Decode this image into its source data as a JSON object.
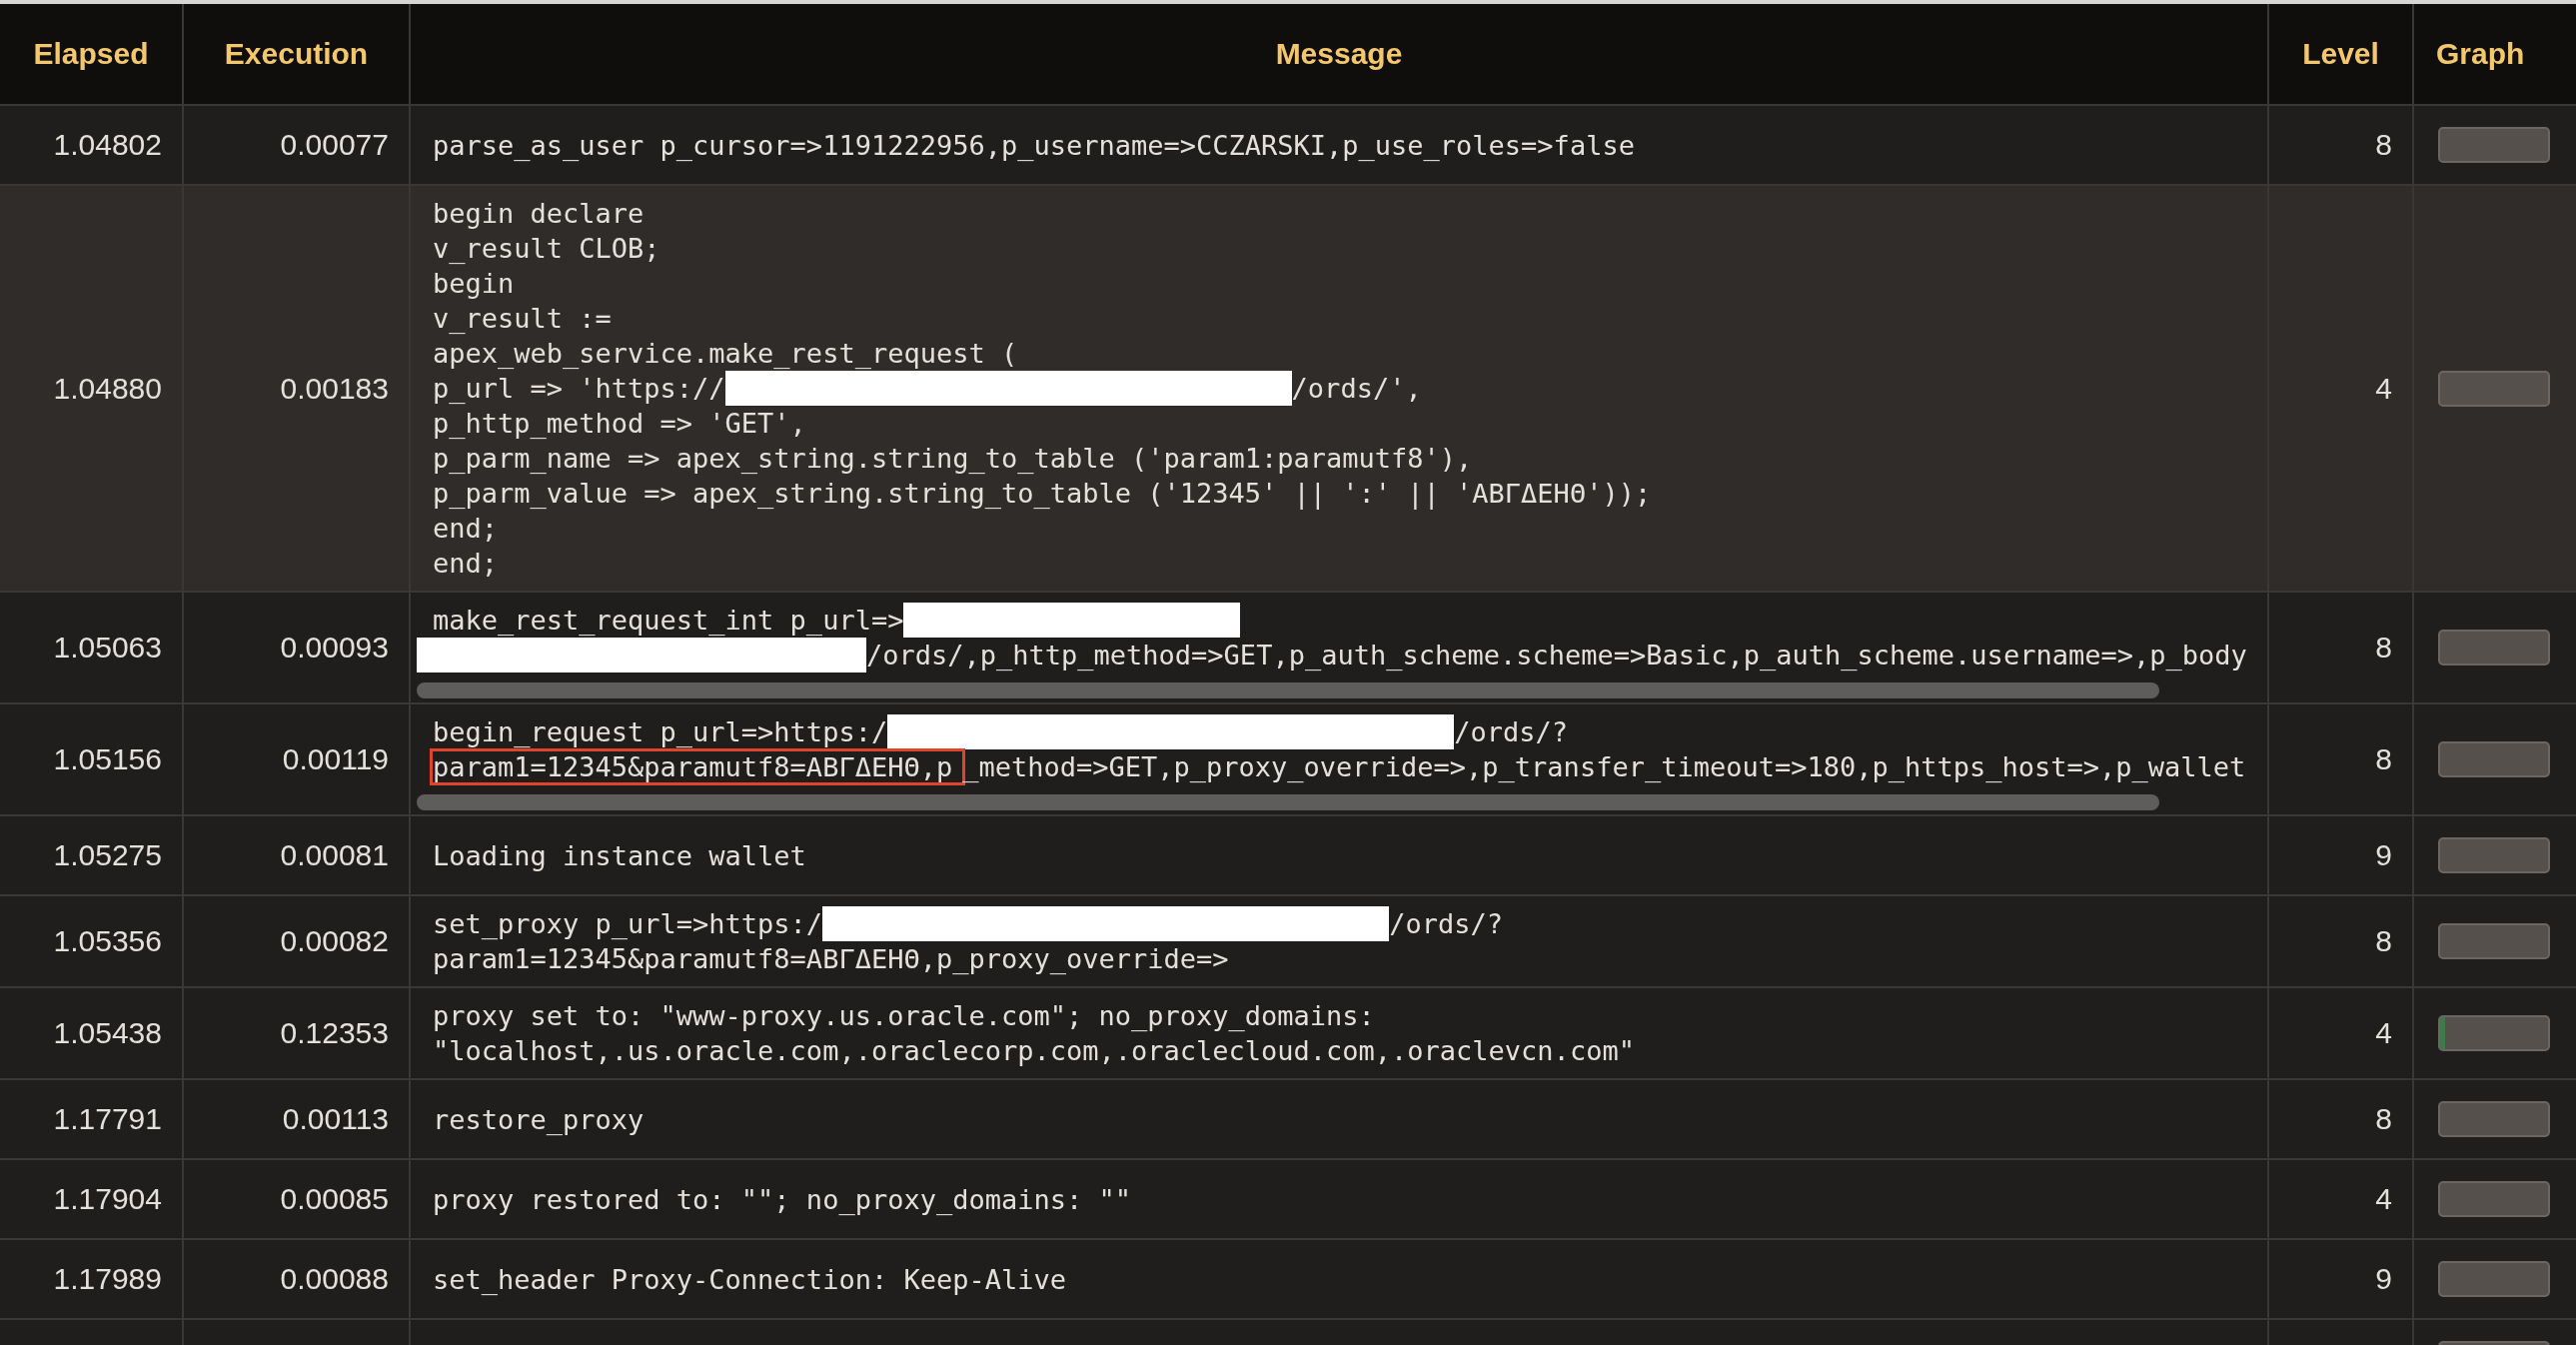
{
  "table": {
    "columns": [
      "Elapsed",
      "Execution",
      "Message",
      "Level",
      "Graph"
    ],
    "rows": [
      {
        "elapsed": "1.04802",
        "execution": "0.00077",
        "hovered": false,
        "scrollable": false,
        "message": [
          [
            {
              "kind": "text",
              "text": "parse_as_user p_cursor=>1191222956,p_username=>CCZARSKI,p_use_roles=>false"
            }
          ]
        ],
        "level_text": "8"
      },
      {
        "elapsed": "1.04880",
        "execution": "0.00183",
        "hovered": true,
        "scrollable": false,
        "message": [
          [
            {
              "kind": "text",
              "text": "begin declare"
            }
          ],
          [
            {
              "kind": "text",
              "text": "v_result CLOB;"
            }
          ],
          [
            {
              "kind": "text",
              "text": "begin"
            }
          ],
          [
            {
              "kind": "text",
              "text": "v_result :="
            }
          ],
          [
            {
              "kind": "text",
              "text": "apex_web_service.make_rest_request ("
            }
          ],
          [
            {
              "kind": "text",
              "text": "p_url => 'https://"
            },
            {
              "kind": "redacted"
            },
            {
              "kind": "text",
              "text": "/ords/',"
            }
          ],
          [
            {
              "kind": "text",
              "text": "p_http_method => 'GET',"
            }
          ],
          [
            {
              "kind": "text",
              "text": "p_parm_name => apex_string.string_to_table ('param1:paramutf8'),"
            }
          ],
          [
            {
              "kind": "text",
              "text": "p_parm_value => apex_string.string_to_table ('12345' || ':' || 'ΑΒΓΔΕΗΘ'));"
            }
          ],
          [
            {
              "kind": "text",
              "text": "end;"
            }
          ],
          [
            {
              "kind": "text",
              "text": "end;"
            }
          ]
        ],
        "level_text": "4"
      },
      {
        "elapsed": "1.05063",
        "execution": "0.00093",
        "hovered": false,
        "scrollable": true,
        "message": [
          [
            {
              "kind": "text",
              "text": "make_rest_request_int p_url=>"
            },
            {
              "kind": "redacted_short"
            }
          ],
          [
            {
              "kind": "redacted_medium"
            },
            {
              "kind": "text",
              "text": "/ords/,p_http_method=>GET,p_auth_scheme.scheme=>Basic,p_auth_scheme.username=>,p_body"
            }
          ]
        ],
        "level_text": "8"
      },
      {
        "elapsed": "1.05156",
        "execution": "0.00119",
        "hovered": false,
        "scrollable": true,
        "message": [
          [
            {
              "kind": "text",
              "text": "begin_request p_url=>https:/"
            },
            {
              "kind": "redacted"
            },
            {
              "kind": "text",
              "text": "/ords/?"
            }
          ],
          [
            {
              "kind": "highlight",
              "text": "param1=12345&paramutf8=ΑΒΓΔΕΗΘ,p"
            },
            {
              "kind": "text",
              "text": "_method=>GET,p_proxy_override=>,p_transfer_timeout=>180,p_https_host=>,p_wallet"
            }
          ]
        ],
        "level_text": "8"
      },
      {
        "elapsed": "1.05275",
        "execution": "0.00081",
        "hovered": false,
        "scrollable": false,
        "message": [
          [
            {
              "kind": "text",
              "text": "Loading instance wallet"
            }
          ]
        ],
        "level_text": "9"
      },
      {
        "elapsed": "1.05356",
        "execution": "0.00082",
        "hovered": false,
        "scrollable": false,
        "message": [
          [
            {
              "kind": "text",
              "text": "set_proxy p_url=>https:/"
            },
            {
              "kind": "redacted"
            },
            {
              "kind": "text",
              "text": "/ords/?"
            }
          ],
          [
            {
              "kind": "text",
              "text": "param1=12345&paramutf8=ΑΒΓΔΕΗΘ,p_proxy_override=>"
            }
          ]
        ],
        "level_text": "8"
      },
      {
        "elapsed": "1.05438",
        "execution": "0.12353",
        "hovered": false,
        "scrollable": false,
        "message": [
          [
            {
              "kind": "text",
              "text": "proxy set to: \"www-proxy.us.oracle.com\"; no_proxy_domains:"
            }
          ],
          [
            {
              "kind": "text",
              "text": "\"localhost,.us.oracle.com,.oraclecorp.com,.oraclecloud.com,.oraclevcn.com\""
            }
          ]
        ],
        "level_text": "4",
        "graph": {
          "level": 0.05
        }
      },
      {
        "elapsed": "1.17791",
        "execution": "0.00113",
        "hovered": false,
        "scrollable": false,
        "message": [
          [
            {
              "kind": "text",
              "text": "restore_proxy"
            }
          ]
        ],
        "level_text": "8"
      },
      {
        "elapsed": "1.17904",
        "execution": "0.00085",
        "hovered": false,
        "scrollable": false,
        "message": [
          [
            {
              "kind": "text",
              "text": "proxy restored to: \"\"; no_proxy_domains: \"\""
            }
          ]
        ],
        "level_text": "4"
      },
      {
        "elapsed": "1.17989",
        "execution": "0.00088",
        "hovered": false,
        "scrollable": false,
        "message": [
          [
            {
              "kind": "text",
              "text": "set_header Proxy-Connection: Keep-Alive"
            }
          ]
        ],
        "level_text": "9"
      },
      {
        "hovered": false,
        "scrollable": false
      }
    ]
  }
}
